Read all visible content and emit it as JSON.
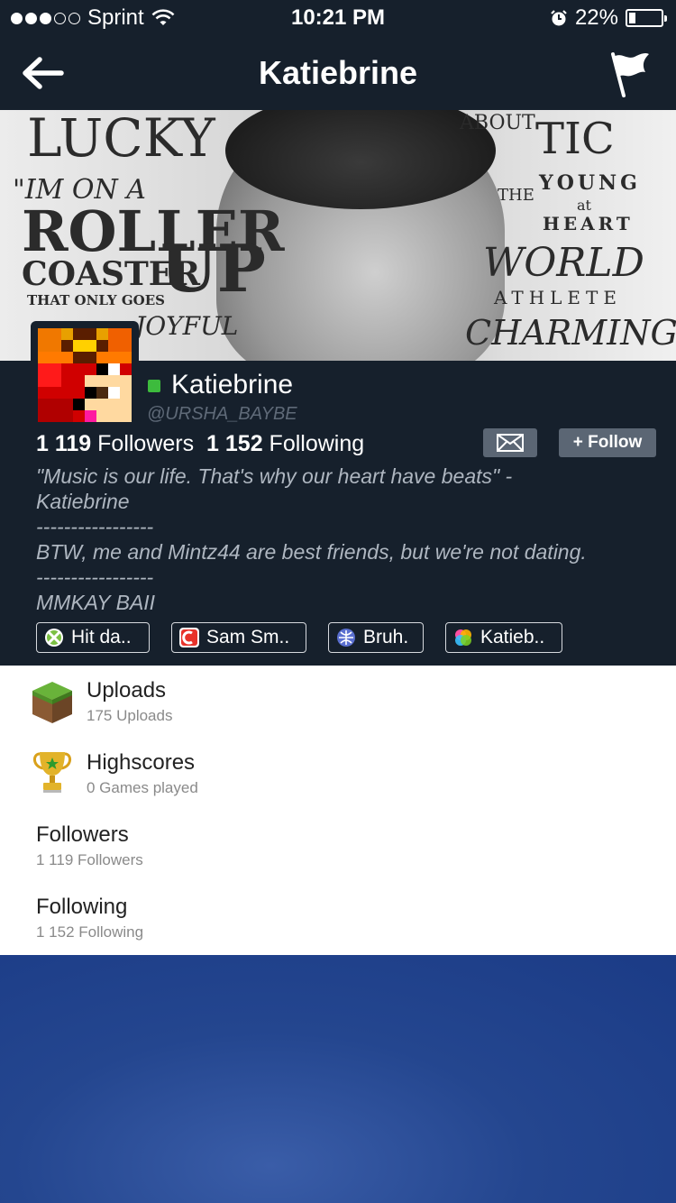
{
  "status_bar": {
    "carrier": "Sprint",
    "time": "10:21 PM",
    "battery": "22%",
    "battery_level": 0.22
  },
  "nav": {
    "title": "Katiebrine"
  },
  "banner": {
    "words": {
      "lucky": "LUCKY",
      "im_on_a": "\"IM ON A",
      "roller": "ROLLER",
      "coaster": "COASTER",
      "up": "UP",
      "only_goes": "THAT ONLY GOES",
      "joyful": "JOYFUL",
      "about": "ABOUT",
      "tic": "TIC",
      "young": "YOUNG",
      "at": "at",
      "heart": "HEART",
      "the": "THE",
      "world": "WORLD",
      "athlete": "ATHLETE",
      "charming": "CHARMING"
    }
  },
  "profile": {
    "username": "Katiebrine",
    "handle": "@URSHA_BAYBE",
    "followers_count": "1 119",
    "followers_label": "Followers",
    "following_count": "1 152",
    "following_label": "Following",
    "follow_button": "+ Follow",
    "bio": [
      "\"Music is our life. That's why our heart have beats\" -",
      "Katiebrine",
      "-----------------",
      "BTW, me and Mintz44 are best friends, but we're not dating.",
      "-----------------",
      "MMKAY BAII"
    ],
    "favorites": [
      {
        "label": "Hit da..",
        "icon": "xbox-icon"
      },
      {
        "label": "Sam Sm..",
        "icon": "sam-smith-icon"
      },
      {
        "label": "Bruh.",
        "icon": "sports-icon"
      },
      {
        "label": "Katieb..",
        "icon": "colorful-icon"
      }
    ]
  },
  "menu": [
    {
      "title": "Uploads",
      "subtitle": "175 Uploads",
      "icon": "grass-block-icon"
    },
    {
      "title": "Highscores",
      "subtitle": "0 Games played",
      "icon": "trophy-icon"
    },
    {
      "title": "Followers",
      "subtitle": "1 119 Followers"
    },
    {
      "title": "Following",
      "subtitle": "1 152 Following"
    }
  ]
}
